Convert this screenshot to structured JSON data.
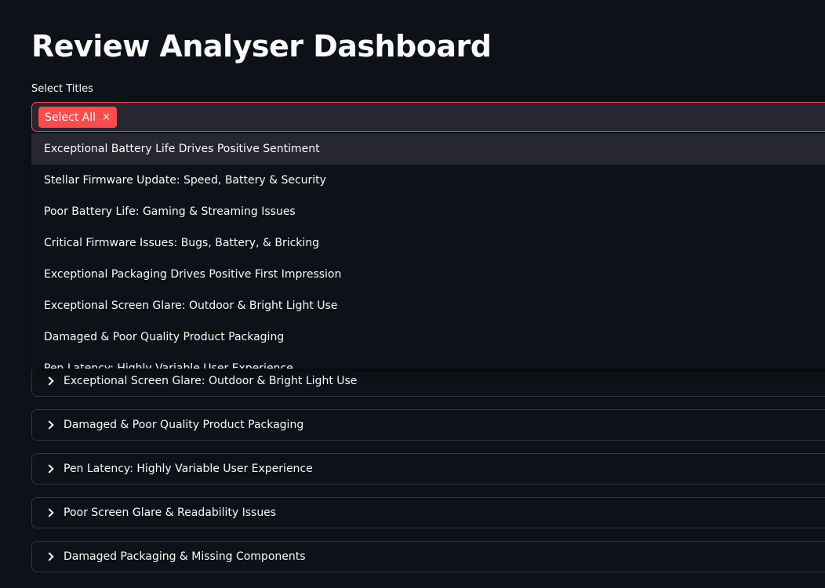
{
  "header": {
    "title": "Review Analyser Dashboard"
  },
  "select": {
    "label": "Select Titles",
    "selected_tag": "Select All",
    "tag_remove_glyph": "×"
  },
  "dropdown": {
    "options": [
      "Exceptional Battery Life Drives Positive Sentiment",
      "Stellar Firmware Update: Speed, Battery & Security",
      "Poor Battery Life: Gaming & Streaming Issues",
      "Critical Firmware Issues: Bugs, Battery, & Bricking",
      "Exceptional Packaging Drives Positive First Impression",
      "Exceptional Screen Glare: Outdoor & Bright Light Use",
      "Damaged & Poor Quality Product Packaging",
      "Pen Latency: Highly Variable User Experience"
    ]
  },
  "expanders": {
    "items": [
      "Exceptional Screen Glare: Outdoor & Bright Light Use",
      "Damaged & Poor Quality Product Packaging",
      "Pen Latency: Highly Variable User Experience",
      "Poor Screen Glare & Readability Issues",
      "Damaged Packaging & Missing Components"
    ]
  },
  "colors": {
    "background": "#0e1117",
    "accent": "#ff4b4b",
    "input_background": "#262730",
    "border": "#31333f"
  }
}
